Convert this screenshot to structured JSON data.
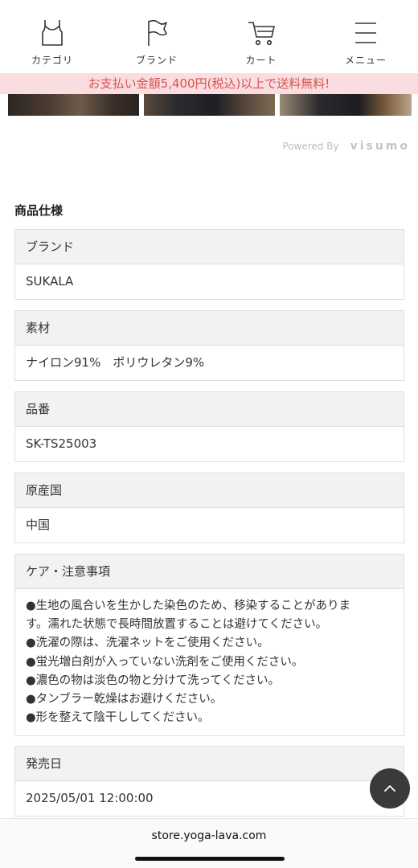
{
  "nav": {
    "items": [
      {
        "label": "カテゴリ",
        "icon": "tank-top-icon"
      },
      {
        "label": "ブランド",
        "icon": "flag-icon"
      },
      {
        "label": "カート",
        "icon": "cart-icon"
      },
      {
        "label": "メニュー",
        "icon": "hamburger-menu-icon"
      }
    ]
  },
  "promo": {
    "text": "お支払い金額5,400円(税込)以上で送料無料!"
  },
  "powered": {
    "label": "Powered By",
    "brand": "visumo"
  },
  "specs": {
    "title": "商品仕様",
    "items": [
      {
        "label": "ブランド",
        "value": "SUKALA"
      },
      {
        "label": "素材",
        "value": "ナイロン91%　ポリウレタン9%"
      },
      {
        "label": "品番",
        "value": "SK-TS25003"
      },
      {
        "label": "原産国",
        "value": "中国"
      },
      {
        "label": "ケア・注意事項",
        "lines": [
          "●生地の風合いを生かした染色のため、移染することがありま",
          "す。濡れた状態で長時間放置することは避けてください。",
          "●洗濯の際は、洗濯ネットをご使用ください。",
          "●蛍光増白剤が入っていない洗剤をご使用ください。",
          "●濃色の物は淡色の物と分けて洗ってください。",
          "●タンブラー乾燥はお避けください。",
          "●形を整えて陰干ししてください。"
        ]
      },
      {
        "label": "発売日",
        "value": "2025/05/01 12:00:00"
      }
    ]
  },
  "browser": {
    "url": "store.yoga-lava.com"
  },
  "colors": {
    "promo_bg": "#f9dde0",
    "promo_text": "#d9534f",
    "spec_head_bg": "#f2f2f2"
  }
}
